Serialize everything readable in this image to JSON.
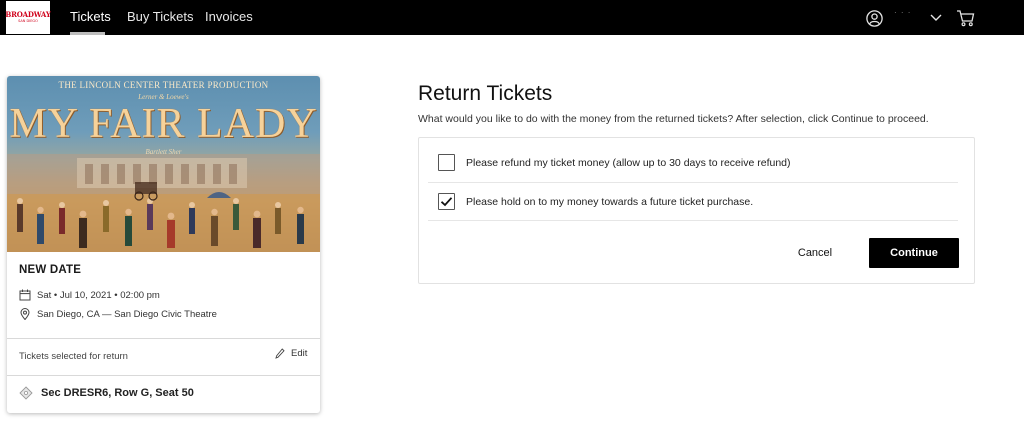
{
  "brand": {
    "logo_main": "BROADWAY",
    "logo_sub": "SAN DIEGO"
  },
  "nav": {
    "items": [
      {
        "label": "Tickets",
        "active": true
      },
      {
        "label": "Buy Tickets",
        "active": false
      },
      {
        "label": "Invoices",
        "active": false
      }
    ],
    "user_name": "· · ·",
    "icons": [
      "user-icon",
      "chevron-down-icon",
      "cart-icon"
    ]
  },
  "event": {
    "poster": {
      "top_line": "THE LINCOLN CENTER THEATER PRODUCTION",
      "sub_line": "Lerner & Loewe's",
      "title": "MY FAIR LADY",
      "credit": "Bartlett Sher"
    },
    "status": "NEW DATE",
    "date": "Sat • Jul 10, 2021 • 02:00 pm",
    "venue": "San Diego, CA — San Diego Civic Theatre",
    "selected_label": "Tickets selected for return",
    "edit_label": "Edit",
    "seat": "Sec DRESR6, Row G, Seat 50"
  },
  "return": {
    "title": "Return Tickets",
    "subtitle": "What would you like to do with the money from the returned tickets? After selection, click Continue to proceed.",
    "options": [
      {
        "label": "Please refund my ticket money (allow up to 30 days to receive refund)",
        "checked": false
      },
      {
        "label": "Please hold on to my money towards a future ticket purchase.",
        "checked": true
      }
    ],
    "cancel_label": "Cancel",
    "continue_label": "Continue"
  },
  "colors": {
    "topbar": "#000000",
    "brand_red": "#d0021b",
    "primary_button": "#000000"
  }
}
